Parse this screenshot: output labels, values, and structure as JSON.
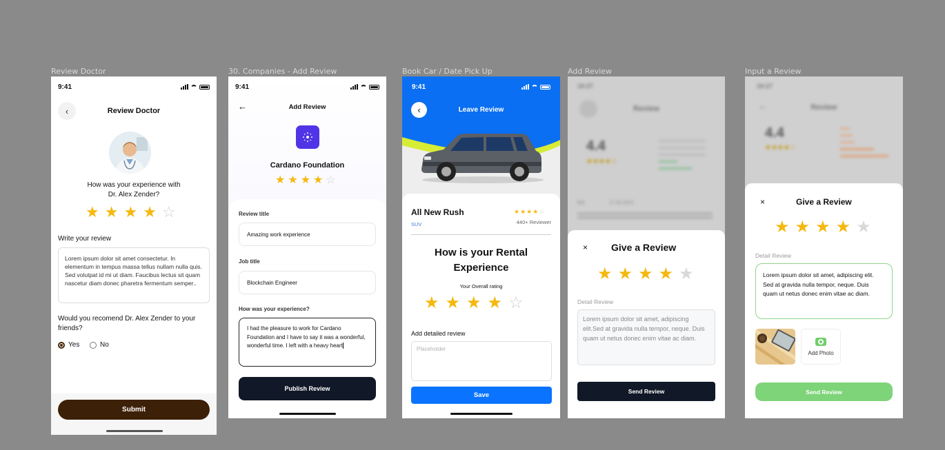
{
  "frames": [
    {
      "label": "Review Doctor"
    },
    {
      "label": "30. Companies - Add Review"
    },
    {
      "label": "Book Car / Date Pick Up"
    },
    {
      "label": "Add Review"
    },
    {
      "label": "Input a Review"
    }
  ],
  "status_time": "9:41",
  "status_time_blurred": "19:27",
  "doctor": {
    "title": "Review Doctor",
    "question_line1": "How was your experience with",
    "question_line2": "Dr. Alex Zender?",
    "rating": 4,
    "write_label": "Write your review",
    "review_text": "Lorem ipsum dolor sit amet consectetur. In elementum in tempus massa tellus nullam nulla quis. Sed volutpat id mi ut diam. Faucibus lectus sit quam nascetur diam donec pharetra fermentum semper..",
    "recommend_question": "Would you recomend Dr. Alex Zender to your friends?",
    "opt_yes": "Yes",
    "opt_no": "No",
    "submit_label": "Submit",
    "colors": {
      "submit": "#3d2008",
      "accent": "#4a2a0c"
    }
  },
  "company": {
    "title": "Add Review",
    "name": "Cardano Foundation",
    "rating": 4,
    "review_title_label": "Review title",
    "review_title_value": "Amazing work experience",
    "job_title_label": "Job title",
    "job_title_value": "Blockchain Engineer",
    "experience_label": "How was your experience?",
    "experience_text": "I had the pleasure to work for Cardano Foundation and I have to say it was a wonderful, wonderful time. I left with a heavy heart",
    "publish_label": "Publish Review",
    "colors": {
      "logo": "#4f35e6",
      "button": "#111827"
    }
  },
  "car": {
    "title": "Leave Review",
    "car_name": "All New Rush",
    "car_type": "SUV",
    "reviewers": "440+ Reviewer",
    "heading_line1": "How is your Rental",
    "heading_line2": "Experience",
    "overall_label": "Your Overall rating",
    "rating": 4,
    "detail_label": "Add detailed review",
    "placeholder": "Placeholder",
    "save_label": "Save",
    "colors": {
      "header": "#0a6ff2",
      "stripe": "#d7ec35",
      "button": "#0a73ff"
    }
  },
  "add_review": {
    "bg_title": "Review",
    "bg_score": "4.4",
    "bg_meta": "4.4",
    "bg_date": "17.04.2023",
    "sheet_title": "Give a Review",
    "rating": 4,
    "detail_label": "Detail Review",
    "detail_text": "Lorem ipsum dolor sit amet, adipiscing elit.Sed at gravida nulla tempor, neque. Duis quam ut netus donec enim vitae ac diam.",
    "send_label": "Send Review",
    "colors": {
      "button": "#111827"
    }
  },
  "input_review": {
    "bg_title": "Review",
    "bg_score": "4.4",
    "sheet_title": "Give a Review",
    "rating": 4,
    "detail_label": "Detail Review",
    "detail_text": "Lorem ipsum dolor sit amet, adipiscing elit. Sed at gravida nulla tempor, neque. Duis quam ut netus donec enim vitae ac diam.",
    "add_photo_label": "Add Photo",
    "send_label": "Send Review",
    "colors": {
      "button": "#7ed479",
      "border": "#8fd68a"
    }
  }
}
